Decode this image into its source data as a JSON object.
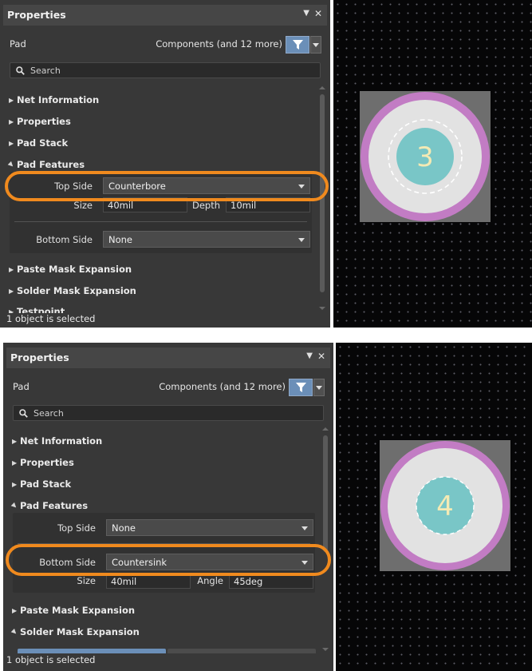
{
  "panels": [
    {
      "title": "Properties",
      "pin_glyph": "▼",
      "close_glyph": "✕",
      "object_type": "Pad",
      "filter_label": "Components (and 12 more)",
      "search_placeholder": "Search",
      "sections": {
        "net_information": "Net Information",
        "properties": "Properties",
        "pad_stack": "Pad Stack",
        "pad_features": "Pad Features",
        "paste_mask_expansion": "Paste Mask Expansion",
        "solder_mask_expansion": "Solder Mask Expansion",
        "testpoint": "Testpoint"
      },
      "pad_features": {
        "top_side_label": "Top Side",
        "top_side_value": "Counterbore",
        "size_label": "Size",
        "size_value": "40mil",
        "depth_label": "Depth",
        "depth_value": "10mil",
        "bottom_side_label": "Bottom Side",
        "bottom_side_value": "None"
      },
      "status": "1 object is selected",
      "pad_designator": "3",
      "highlight_color": "#f08a1e"
    },
    {
      "title": "Properties",
      "pin_glyph": "▼",
      "close_glyph": "✕",
      "object_type": "Pad",
      "filter_label": "Components (and 12 more)",
      "search_placeholder": "Search",
      "sections": {
        "net_information": "Net Information",
        "properties": "Properties",
        "pad_stack": "Pad Stack",
        "pad_features": "Pad Features",
        "paste_mask_expansion": "Paste Mask Expansion",
        "solder_mask_expansion": "Solder Mask Expansion"
      },
      "pad_features": {
        "top_side_label": "Top Side",
        "top_side_value": "None",
        "bottom_side_label": "Bottom Side",
        "bottom_side_value": "Countersink",
        "size_label": "Size",
        "size_value": "40mil",
        "angle_label": "Angle",
        "angle_value": "45deg"
      },
      "status": "1 object is selected",
      "pad_designator": "4",
      "highlight_color": "#f08a1e"
    }
  ],
  "colors": {
    "panel_bg": "#383838",
    "pcb_bg": "#060607",
    "pad_ring": "#c27cc4",
    "pad_annulus": "#e2e2e2",
    "drill": "#79c6c7",
    "filter_button": "#6b8fb8",
    "square_pad": "#6e6e6e"
  }
}
